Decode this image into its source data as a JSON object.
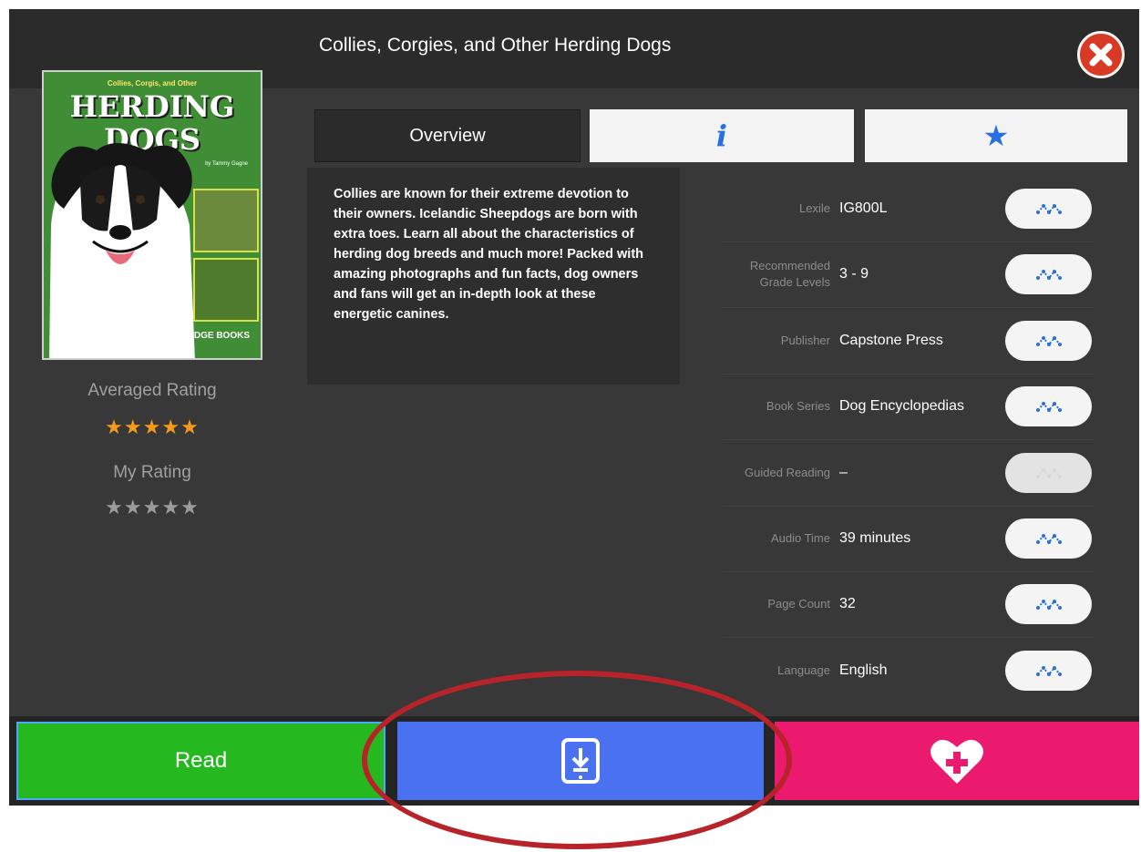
{
  "header": {
    "title": "Collies, Corgies, and Other Herding Dogs"
  },
  "cover": {
    "top_text": "Collies, Corgis, and Other",
    "title_line1": "HERDING",
    "title_line2": "DOGS",
    "author": "by Tammy Gagne",
    "publisher_logo": "EDGE BOOKS"
  },
  "ratings": {
    "averaged_label": "Averaged Rating",
    "averaged_value": 5,
    "averaged_max": 5,
    "my_label": "My Rating",
    "my_value": 0,
    "my_max": 5
  },
  "tabs": {
    "overview_label": "Overview",
    "info_icon": "info-icon",
    "favorite_icon": "star-icon"
  },
  "description": "Collies are known for their extreme devotion to their owners. Icelandic Sheepdogs are born with extra toes. Learn all about the characteristics of herding dog breeds and much more! Packed with amazing photographs and fun facts, dog owners and fans will get an in-depth look at these energetic canines.",
  "details": [
    {
      "label": "Lexile",
      "value": "IG800L",
      "enabled": true
    },
    {
      "label": "Recommended Grade Levels",
      "value": "3 - 9",
      "enabled": true
    },
    {
      "label": "Publisher",
      "value": "Capstone Press",
      "enabled": true
    },
    {
      "label": "Book Series",
      "value": "Dog Encyclopedias",
      "enabled": true
    },
    {
      "label": "Guided Reading",
      "value": "–",
      "enabled": false
    },
    {
      "label": "Audio Time",
      "value": "39 minutes",
      "enabled": true
    },
    {
      "label": "Page Count",
      "value": "32",
      "enabled": true
    },
    {
      "label": "Language",
      "value": "English",
      "enabled": true
    }
  ],
  "actions": {
    "read_label": "Read",
    "download_icon": "tablet-download-icon",
    "wishlist_icon": "heart-plus-icon"
  },
  "colors": {
    "read": "#25b91f",
    "download": "#4a72f0",
    "wishlist": "#ec1a6e",
    "star_filled": "#f59a1b",
    "star_empty": "#9b9b9b",
    "accent": "#2a6fe0",
    "annotation_circle": "#b8232a"
  }
}
